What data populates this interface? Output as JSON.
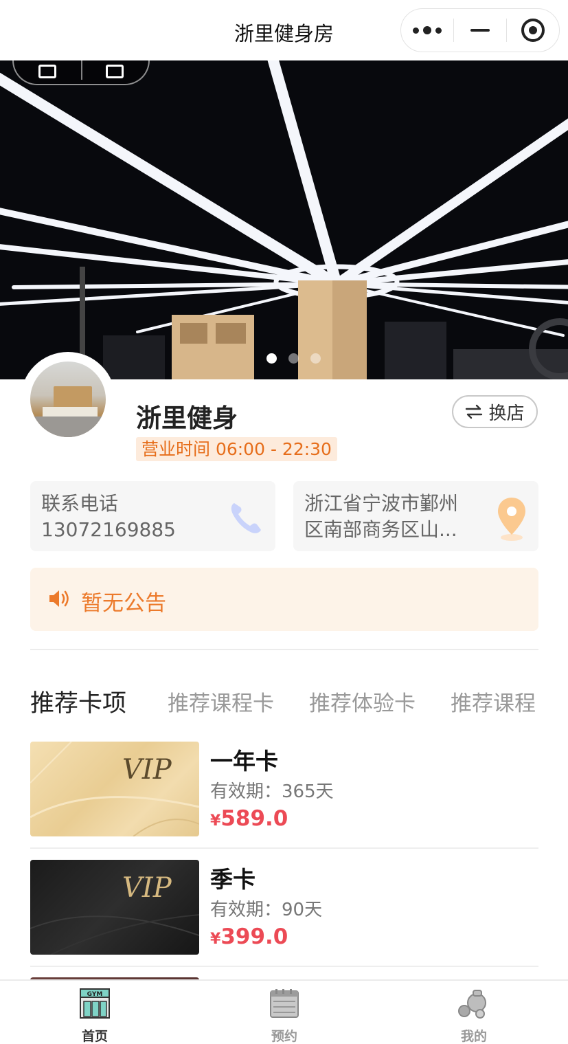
{
  "navbar": {
    "title": "浙里健身房"
  },
  "banner": {
    "slides": 3,
    "active_slide": 1
  },
  "gym": {
    "name": "浙里健身",
    "hours": "营业时间 06:00 - 22:30",
    "switch_label": "换店"
  },
  "contact": {
    "phone_label": "联系电话",
    "phone_number": "13072169885",
    "address_line1": "浙江省宁波市鄞州",
    "address_line2": "区南部商务区山..."
  },
  "notice": {
    "text": "暂无公告"
  },
  "tabs": [
    {
      "label": "推荐卡项",
      "active": true
    },
    {
      "label": "推荐课程卡",
      "active": false
    },
    {
      "label": "推荐体验卡",
      "active": false
    },
    {
      "label": "推荐课程",
      "active": false
    }
  ],
  "products": [
    {
      "name": "一年卡",
      "validity": "有效期：365天",
      "currency": "¥",
      "price": "589.0",
      "thumb_text": "VIP",
      "style": "gold"
    },
    {
      "name": "季卡",
      "validity": "有效期：90天",
      "currency": "¥",
      "price": "399.0",
      "thumb_text": "VIP",
      "style": "black"
    }
  ],
  "tabbar": {
    "items": [
      {
        "label": "首页",
        "icon": "gym-icon",
        "active": true
      },
      {
        "label": "预约",
        "icon": "calendar-icon",
        "active": false
      },
      {
        "label": "我的",
        "icon": "dumbbell-icon",
        "active": false
      }
    ]
  },
  "colors": {
    "accent_orange": "#ec7a2b",
    "price_red": "#ec4a55",
    "notice_bg": "#fdf3e8"
  }
}
